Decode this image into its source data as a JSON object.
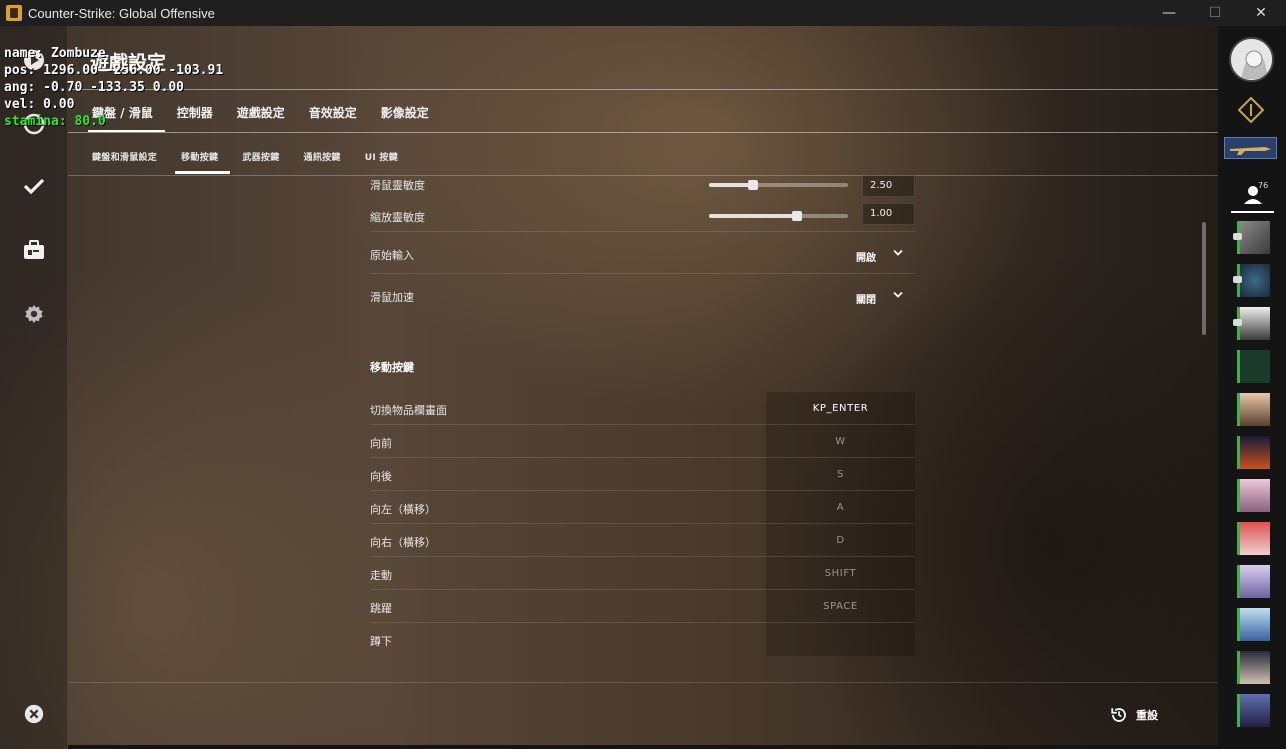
{
  "window": {
    "title": "Counter-Strike: Global Offensive",
    "min": "—",
    "max": "☐",
    "close": "✕"
  },
  "debug": {
    "name": "name: Zombuze",
    "pos": "pos:  1296.00 -256.00 -103.91",
    "ang": "ang:  -0.70 -133.35 0.00",
    "vel": "vel:  0.00",
    "stamina": "stamina:  80.0"
  },
  "page_title": "遊戲設定",
  "tabs": [
    {
      "label": "鍵盤 / 滑鼠",
      "active": true
    },
    {
      "label": "控制器"
    },
    {
      "label": "遊戲設定"
    },
    {
      "label": "音效設定"
    },
    {
      "label": "影像設定"
    }
  ],
  "subtabs": [
    {
      "label": "鍵盤和滑鼠設定"
    },
    {
      "label": "移動按鍵",
      "active": true
    },
    {
      "label": "武器按鍵"
    },
    {
      "label": "通訊按鍵"
    },
    {
      "label": "UI 按鍵"
    }
  ],
  "settings": {
    "mouse_sensitivity": {
      "label": "滑鼠靈敏度",
      "value": "2.50",
      "slider_fraction": 0.32
    },
    "zoom_sensitivity": {
      "label": "縮放靈敏度",
      "value": "1.00",
      "slider_fraction": 0.63
    },
    "raw_input": {
      "label": "原始輸入",
      "value": "開啟"
    },
    "mouse_accel": {
      "label": "滑鼠加速",
      "value": "關閉"
    }
  },
  "movement": {
    "title": "移動按鍵",
    "bindings": [
      {
        "action": "切換物品欄畫面",
        "key": "KP_ENTER"
      },
      {
        "action": "向前",
        "key": "W"
      },
      {
        "action": "向後",
        "key": "S"
      },
      {
        "action": "向左（橫移）",
        "key": "A"
      },
      {
        "action": "向右（橫移）",
        "key": "D"
      },
      {
        "action": "走動",
        "key": "SHIFT"
      },
      {
        "action": "跳躍",
        "key": "SPACE"
      },
      {
        "action": "蹲下",
        "key": ""
      }
    ]
  },
  "reset_label": "重設",
  "friends": {
    "count": "76"
  },
  "colors": {
    "accent_green": "#3db04a",
    "debug_green": "#2ee62e"
  }
}
